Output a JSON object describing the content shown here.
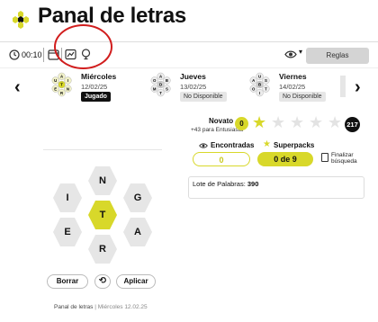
{
  "app": {
    "title": "Panal de letras"
  },
  "toolbar": {
    "time": "00:10",
    "rules_label": "Reglas"
  },
  "days": [
    {
      "name": "Miércoles",
      "date": "12/02/25",
      "status": "Jugado",
      "center": "T",
      "letters": [
        "A",
        "U",
        "I",
        "E",
        "N",
        "R"
      ],
      "selected": true
    },
    {
      "name": "Jueves",
      "date": "13/02/25",
      "status": "No Disponible",
      "center": "D",
      "letters": [
        "A",
        "O",
        "B",
        "M",
        "S",
        "T"
      ],
      "selected": false
    },
    {
      "name": "Viernes",
      "date": "14/02/25",
      "status": "No Disponible",
      "center": "B",
      "letters": [
        "U",
        "A",
        "S",
        "O",
        "T",
        "I"
      ],
      "selected": false
    }
  ],
  "level": {
    "name": "Novato",
    "next_hint": "+43 para Entusiasta",
    "current": "0",
    "max": "217",
    "stars_filled": 1,
    "stars_total": 5
  },
  "stats": {
    "found_label": "Encontradas",
    "found_value": "0",
    "superpacks_label": "Superpacks",
    "superpacks_value": "0 de 9",
    "finish_label_1": "Finalizar",
    "finish_label_2": "búsqueda"
  },
  "lote": {
    "label": "Lote de Palabras:",
    "value": "390"
  },
  "hive": {
    "center": "T",
    "outer": {
      "top": "N",
      "upper_left": "I",
      "upper_right": "G",
      "lower_left": "E",
      "lower_right": "A",
      "bottom": "R"
    }
  },
  "controls": {
    "delete": "Borrar",
    "shuffle_icon": "refresh-icon",
    "apply": "Aplicar"
  },
  "footer": {
    "app_name": "Panal de letras",
    "sep": "|",
    "day_info": "Miércoles 12.02.25"
  },
  "colors": {
    "accent": "#d8d82a",
    "annotation": "#d11d1d",
    "dark": "#111111"
  }
}
